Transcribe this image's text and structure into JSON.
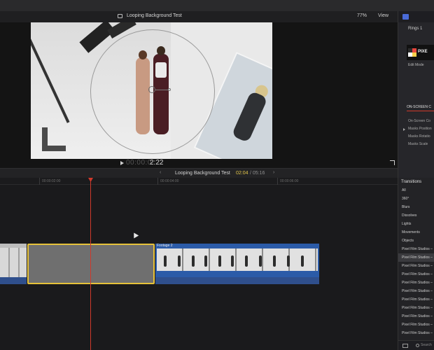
{
  "viewer": {
    "title": "Looping Background Test",
    "zoom": "77%",
    "view_menu": "View",
    "timecode_dim": "00:00:0",
    "timecode": "2:22"
  },
  "timeline": {
    "project_title": "Looping Background Test",
    "current_time": "02:04",
    "duration": "/ 05:16",
    "ruler_ticks": [
      "00:00:02:00",
      "00:00:04:00",
      "00:00:06:00"
    ],
    "clip_label": "Footage 2"
  },
  "inspector": {
    "title": "Rings 1",
    "logo_text": "PIXE",
    "edit_mode": "Edit Mode",
    "section": "ON-SCREEN C",
    "rows": [
      "On-Screen Co",
      "Masks Position",
      "Masks Rotatio",
      "Masks Scale"
    ]
  },
  "transitions": {
    "header": "Transitions",
    "categories": [
      "All",
      "360°",
      "Blurs",
      "Dissolves",
      "Lights",
      "Movements",
      "Objects"
    ],
    "items": [
      "Pixel Film Studios –",
      "Pixel Film Studios –",
      "Pixel Film Studios –",
      "Pixel Film Studios –",
      "Pixel Film Studios –",
      "Pixel Film Studios –",
      "Pixel Film Studios –",
      "Pixel Film Studios –",
      "Pixel Film Studios –",
      "Pixel Film Studios –",
      "Pixel Film Studios –"
    ],
    "search_placeholder": "Search"
  },
  "colors": {
    "accent_yellow": "#e6c23a",
    "playhead": "#d0392b",
    "clip_blue": "#2b5ba8"
  }
}
